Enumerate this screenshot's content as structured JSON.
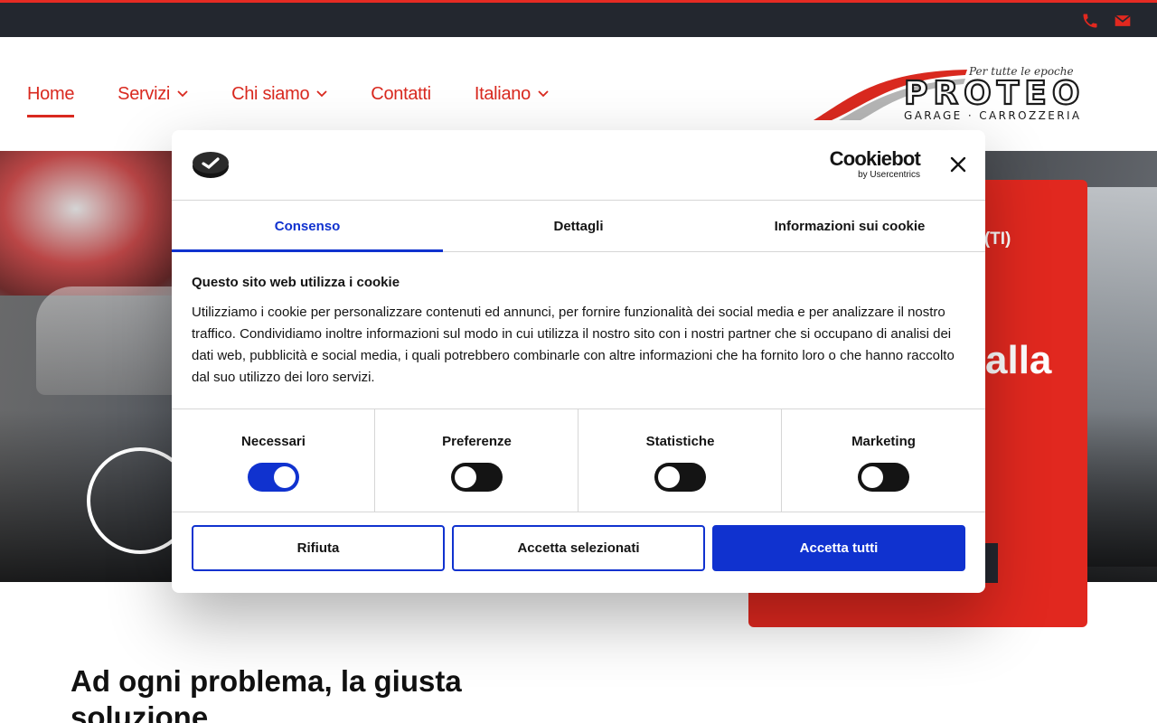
{
  "colors": {
    "brand_red": "#e1281f",
    "dark": "#23272f",
    "cookie_blue": "#1032cf"
  },
  "topbar": {
    "icons": [
      "phone-icon",
      "envelope-icon"
    ]
  },
  "nav": {
    "items": [
      {
        "label": "Home",
        "active": true,
        "has_dropdown": false
      },
      {
        "label": "Servizi",
        "active": false,
        "has_dropdown": true
      },
      {
        "label": "Chi siamo",
        "active": false,
        "has_dropdown": true
      },
      {
        "label": "Contatti",
        "active": false,
        "has_dropdown": false
      },
      {
        "label": "Italiano",
        "active": false,
        "has_dropdown": true
      }
    ]
  },
  "logo": {
    "tagline": "Per tutte le epoche",
    "name": "PROTEO",
    "subtitle": "GARAGE · CARROZZERIA"
  },
  "hero": {
    "card_location_partial": "e (TI)",
    "card_heading_partial": "alla"
  },
  "section": {
    "title": "Ad ogni problema, la giusta soluzione"
  },
  "cookie": {
    "brand": "Cookiebot",
    "brand_sub": "by Usercentrics",
    "tabs": [
      {
        "label": "Consenso",
        "active": true
      },
      {
        "label": "Dettagli",
        "active": false
      },
      {
        "label": "Informazioni sui cookie",
        "active": false
      }
    ],
    "title": "Questo sito web utilizza i cookie",
    "text": "Utilizziamo i cookie per personalizzare contenuti ed annunci, per fornire funzionalità dei social media e per analizzare il nostro traffico. Condividiamo inoltre informazioni sul modo in cui utilizza il nostro sito con i nostri partner che si occupano di analisi dei dati web, pubblicità e social media, i quali potrebbero combinarle con altre informazioni che ha fornito loro o che hanno raccolto dal suo utilizzo dei loro servizi.",
    "toggles": [
      {
        "label": "Necessari",
        "on": true
      },
      {
        "label": "Preferenze",
        "on": false
      },
      {
        "label": "Statistiche",
        "on": false
      },
      {
        "label": "Marketing",
        "on": false
      }
    ],
    "buttons": {
      "reject": "Rifiuta",
      "accept_selected": "Accetta selezionati",
      "accept_all": "Accetta tutti"
    }
  }
}
